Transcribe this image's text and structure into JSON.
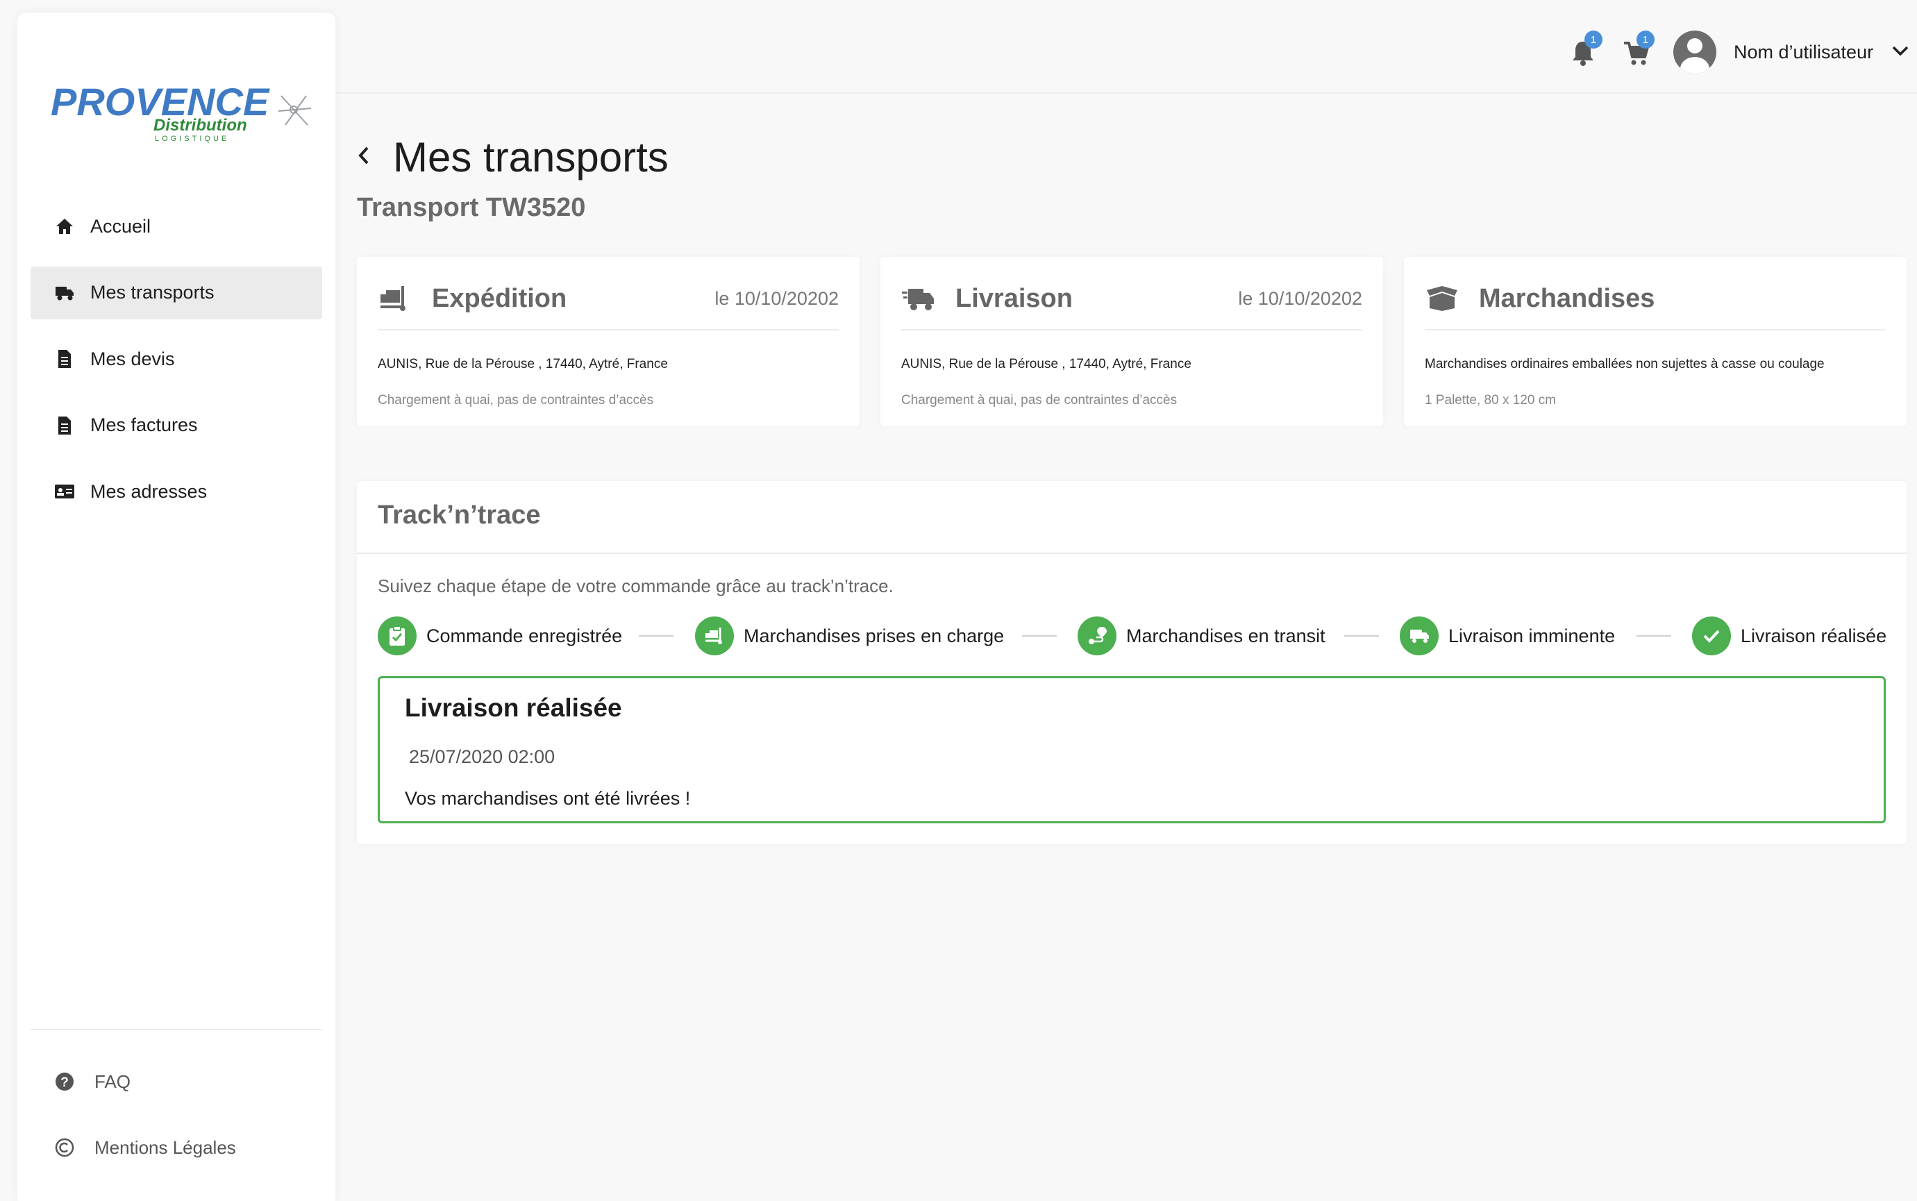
{
  "colors": {
    "accent_green": "#4caf50",
    "badge_blue": "#4a90d9",
    "logo_blue": "#3f7bc4",
    "logo_green": "#2e8b3a",
    "active_nav_bg": "#ebebeb"
  },
  "logo": {
    "word": "PROVENCE",
    "sub": "Distribution",
    "tag": "LOGISTIQUE"
  },
  "sidebar": {
    "items": [
      {
        "label": "Accueil",
        "icon": "home-icon",
        "active": false
      },
      {
        "label": "Mes transports",
        "icon": "truck-icon",
        "active": true
      },
      {
        "label": "Mes devis",
        "icon": "document-icon",
        "active": false
      },
      {
        "label": "Mes factures",
        "icon": "document-icon",
        "active": false
      },
      {
        "label": "Mes adresses",
        "icon": "address-card-icon",
        "active": false
      }
    ],
    "footer": [
      {
        "label": "FAQ",
        "icon": "question-circle-icon"
      },
      {
        "label": "Mentions Légales",
        "icon": "copyright-icon"
      }
    ]
  },
  "header": {
    "notifications_count": "1",
    "cart_count": "1",
    "user_name": "Nom d’utilisateur"
  },
  "page": {
    "title": "Mes transports",
    "subtitle": "Transport TW3520"
  },
  "cards": {
    "expedition": {
      "title": "Expédition",
      "date": "le 10/10/20202",
      "line1": "AUNIS, Rue de la Pérouse , 17440, Aytré, France",
      "line2": "Chargement à quai, pas de contraintes d’accès"
    },
    "livraison": {
      "title": "Livraison",
      "date": "le 10/10/20202",
      "line1": "AUNIS, Rue de la Pérouse , 17440, Aytré, France",
      "line2": "Chargement à quai, pas de contraintes d’accès"
    },
    "marchandises": {
      "title": "Marchandises",
      "line1": "Marchandises ordinaires emballées non sujettes à casse ou coulage",
      "line2": "1 Palette, 80 x 120 cm"
    }
  },
  "track": {
    "title": "Track’n’trace",
    "intro": "Suivez chaque étape de votre commande grâce au track’n’trace.",
    "steps": [
      {
        "label": "Commande enregistrée",
        "icon": "clipboard-check-icon",
        "done": true
      },
      {
        "label": "Marchandises prises en charge",
        "icon": "dolly-icon",
        "done": true
      },
      {
        "label": "Marchandises en transit",
        "icon": "route-icon",
        "done": true
      },
      {
        "label": "Livraison imminente",
        "icon": "truck-icon",
        "done": true
      },
      {
        "label": "Livraison réalisée",
        "icon": "check-icon",
        "done": true
      }
    ],
    "detail": {
      "title": "Livraison réalisée",
      "date": "25/07/2020 02:00",
      "message": "Vos marchandises ont été livrées !"
    }
  }
}
